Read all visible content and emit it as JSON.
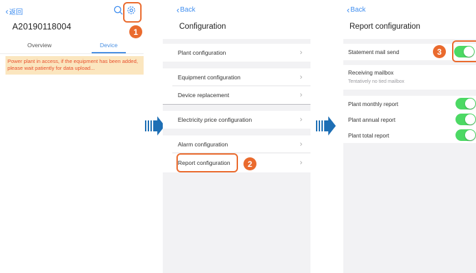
{
  "screen1": {
    "back_label": "返回",
    "device_id": "A20190118004",
    "tabs": [
      {
        "label": "Overview",
        "active": false
      },
      {
        "label": "Device",
        "active": true
      }
    ],
    "warning": "Power plant in access, if the equipment has been added, please wait patiently for data upload...",
    "badge": "1"
  },
  "screen2": {
    "back_label": "Back",
    "title": "Configuration",
    "items": [
      {
        "label": "Plant configuration"
      },
      {
        "label": "Equipment configuration"
      },
      {
        "label": "Device replacement"
      },
      {
        "label": "Electricity price configuration"
      },
      {
        "label": "Alarm configuration"
      },
      {
        "label": "Report configuration"
      }
    ],
    "badge": "2"
  },
  "screen3": {
    "back_label": "Back",
    "title": "Report configuration",
    "statement_mail": {
      "label": "Statement mail send",
      "on": true
    },
    "receiving_mailbox": {
      "label": "Receiving mailbox",
      "value": "Tentatively no tied mailbox"
    },
    "reports": [
      {
        "label": "Plant monthly report",
        "on": true
      },
      {
        "label": "Plant annual report",
        "on": true
      },
      {
        "label": "Plant total report",
        "on": true
      }
    ],
    "badge": "3"
  },
  "colors": {
    "accent_blue": "#3f8ef0",
    "highlight_orange": "#ea6a2d",
    "toggle_green": "#4cd964",
    "warning_bg": "#fbe6bf",
    "warning_text": "#e8512d",
    "flow_arrow": "#1e6fb5"
  },
  "icons": {
    "search": "search-icon",
    "settings": "gear-icon",
    "back": "chevron-left-icon",
    "row_arrow": "chevron-right-icon",
    "flow": "flow-arrow-icon"
  }
}
